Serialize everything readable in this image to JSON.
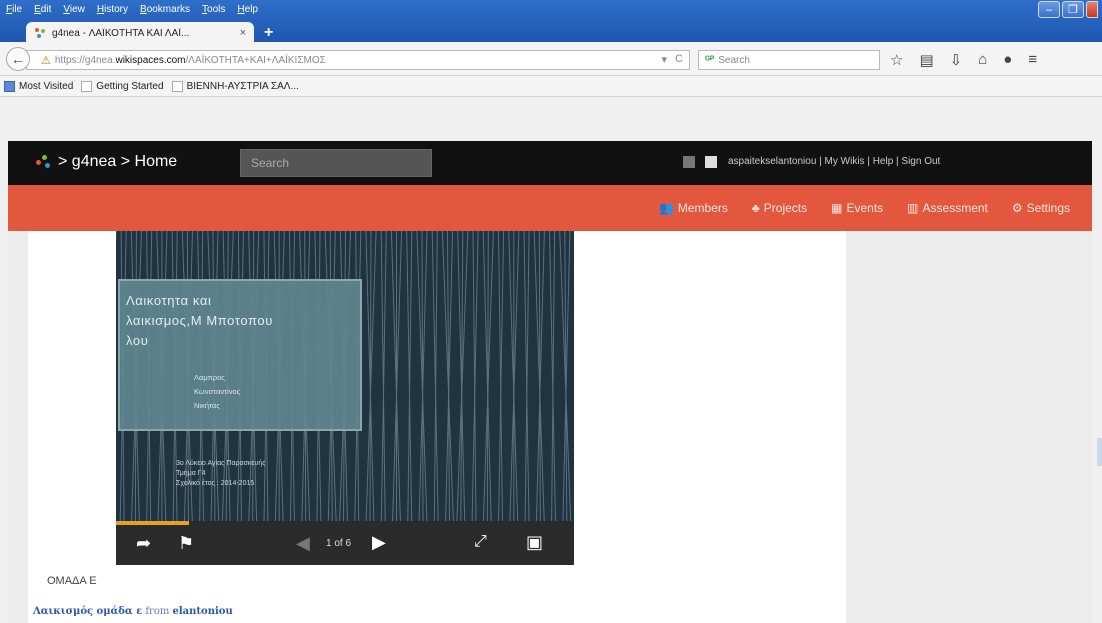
{
  "browser": {
    "menu": [
      "File",
      "Edit",
      "View",
      "History",
      "Bookmarks",
      "Tools",
      "Help"
    ],
    "tab_title": "g4nea - ΛΑΪΚΟΤΗΤΑ ΚΑΙ ΛΑΪ...",
    "tab_close": "×",
    "new_tab": "+",
    "url_prefix": "https://",
    "url_sub": "g4nea.",
    "url_host": "wikispaces.com",
    "url_path": "/ΛΑΪΚΟΤΗΤΑ+ΚΑΙ+ΛΑΪΚΙΣΜΟΣ",
    "search_placeholder": "Search",
    "bookmarks": [
      "Most Visited",
      "Getting Started",
      "ΒΙΕΝΝΗ-ΑΥΣΤΡΙΑ ΣΑΛ..."
    ]
  },
  "site": {
    "brand": "> g4nea > Home",
    "search_placeholder": "Search",
    "user_links": "aspaitekselantoniou  |  My Wikis  |  Help  |  Sign Out",
    "nav": [
      "Members",
      "Projects",
      "Events",
      "Assessment",
      "Settings"
    ]
  },
  "slide": {
    "title_lines": [
      "Λαικοτητα και",
      "λαικισμος,Μ Μποτοπου",
      "λου"
    ],
    "names": [
      "Λαμπρος",
      "Κωνσταντίνος",
      "Νικήτας"
    ],
    "footer": [
      "3ο Λύκειο Αγίας Παρασκευής",
      "Τμήμα Γ4",
      "Σχολικό έτος : 2014-2015"
    ],
    "page_counter": "1 of 6",
    "progress": 0.16
  },
  "content": {
    "group_label": "ΟΜΑΔΑ Ε",
    "link_text": "Λαικισμός ομάδα ε",
    "link_from": " from ",
    "link_user": "elantoniou"
  }
}
